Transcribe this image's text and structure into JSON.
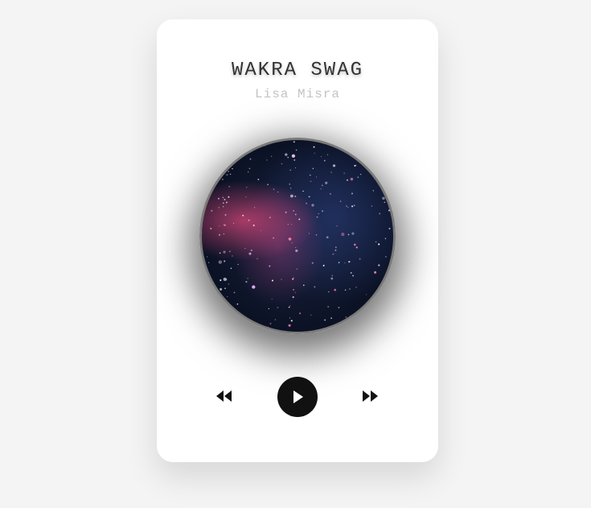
{
  "track": {
    "title": "WAKRA SWAG",
    "artist": "Lisa Misra"
  },
  "artwork": {
    "description_icon": "galaxy-artwork"
  },
  "controls": {
    "prev_icon": "rewind-icon",
    "play_icon": "play-icon",
    "next_icon": "fast-forward-icon",
    "state": "paused"
  },
  "colors": {
    "background": "#f4f4f4",
    "card": "#ffffff",
    "title": "#333333",
    "artist": "#c4c4c4",
    "play_button": "#111111"
  }
}
